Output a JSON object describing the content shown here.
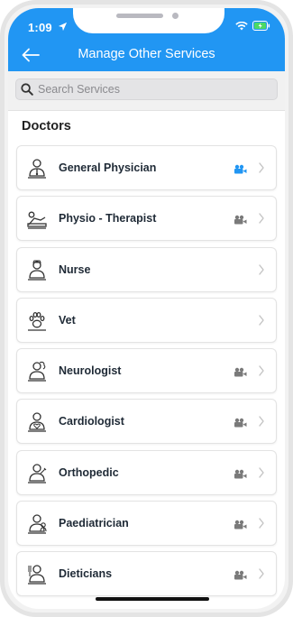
{
  "status_bar": {
    "time": "1:09"
  },
  "header": {
    "title": "Manage Other Services"
  },
  "search": {
    "placeholder": "Search Services"
  },
  "section": {
    "title": "Doctors"
  },
  "colors": {
    "header": "#2196f3",
    "video_active": "#2196f3",
    "video_inactive": "#7a7a7a"
  },
  "services": [
    {
      "label": "General Physician",
      "icon": "general-physician-icon",
      "video": "active"
    },
    {
      "label": "Physio - Therapist",
      "icon": "physiotherapist-icon",
      "video": "inactive"
    },
    {
      "label": "Nurse",
      "icon": "nurse-icon",
      "video": "none"
    },
    {
      "label": "Vet",
      "icon": "paw-icon",
      "video": "none"
    },
    {
      "label": "Neurologist",
      "icon": "neurologist-icon",
      "video": "inactive"
    },
    {
      "label": "Cardiologist",
      "icon": "cardiologist-icon",
      "video": "inactive"
    },
    {
      "label": "Orthopedic",
      "icon": "orthopedic-icon",
      "video": "inactive"
    },
    {
      "label": "Paediatrician",
      "icon": "paediatrician-icon",
      "video": "inactive"
    },
    {
      "label": "Dieticians",
      "icon": "dietician-icon",
      "video": "inactive"
    }
  ]
}
